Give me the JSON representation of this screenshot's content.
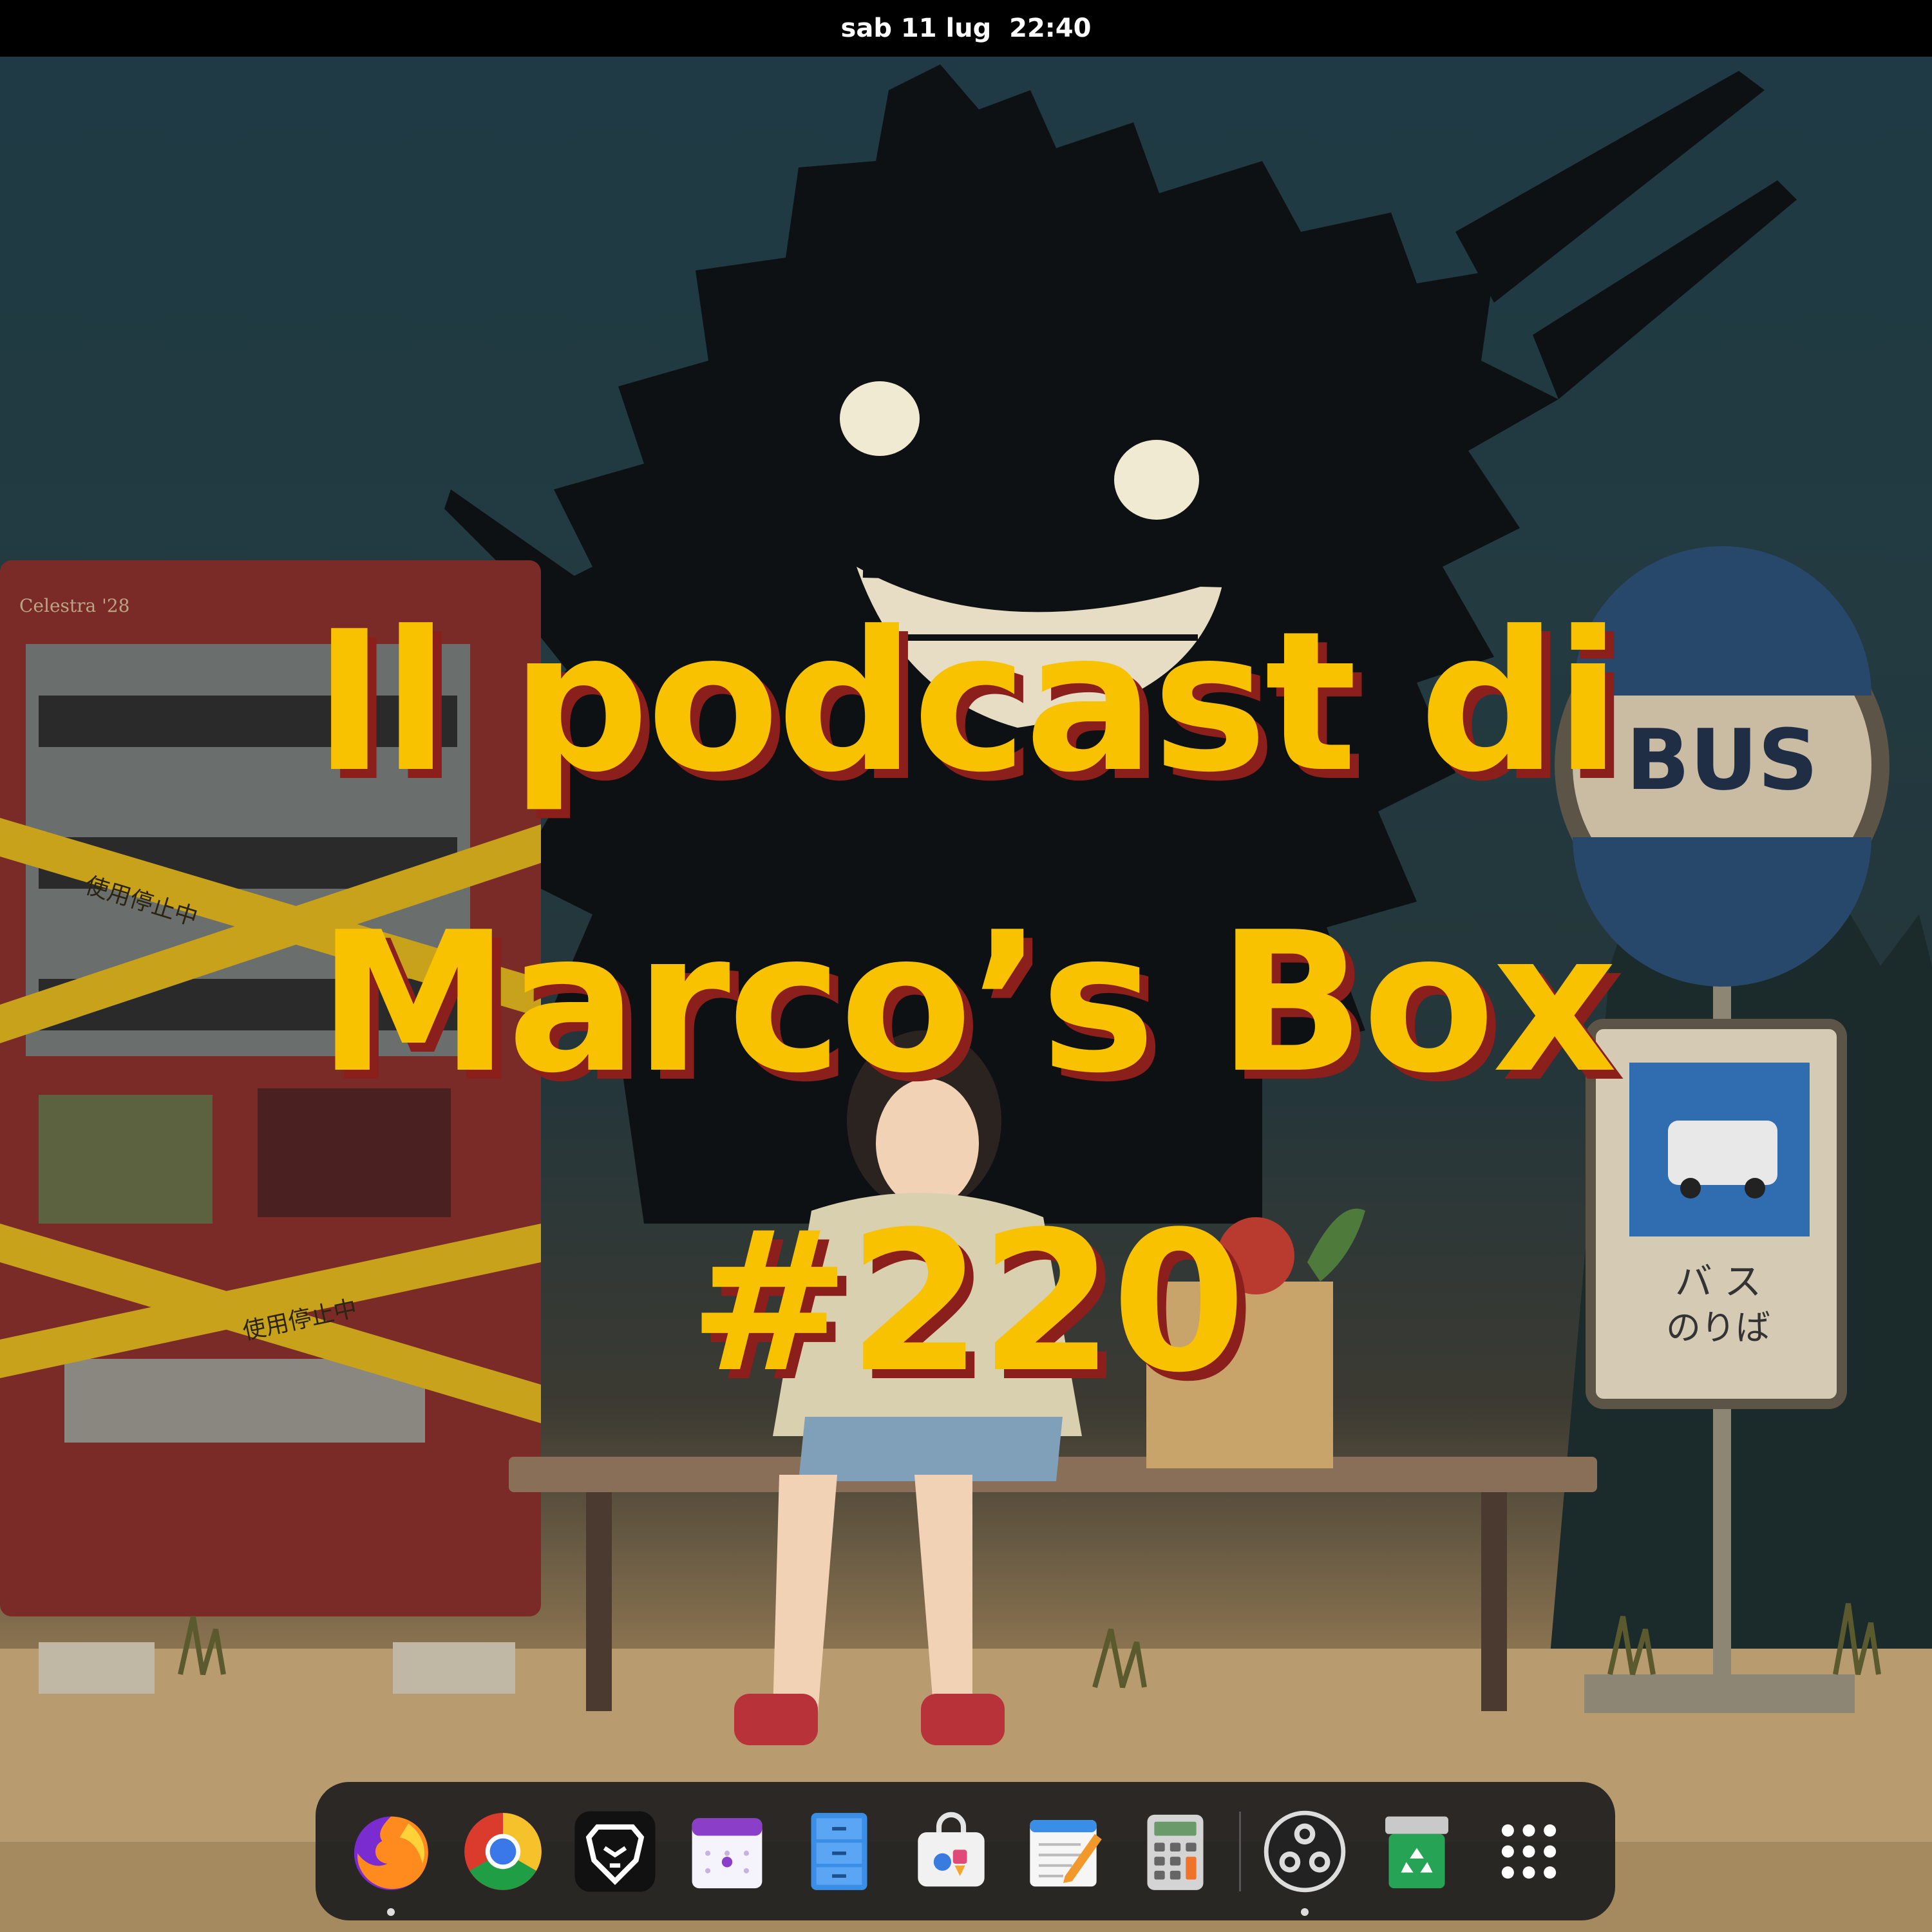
{
  "topbar": {
    "clock": "sab 11 lug  22:40"
  },
  "wallpaper": {
    "title_lines": [
      "Il podcast di",
      "Marco’s Box",
      "#220"
    ],
    "sign_top": "BUS",
    "sign_bottom_line1": "バ ス",
    "sign_bottom_line2": "のりば",
    "tape_text": "使用停止中",
    "artist_signature": "Celestra '28",
    "colors": {
      "title": "#f8c200",
      "title_shadow": "#8b1f1c"
    }
  },
  "dock": {
    "items": [
      {
        "name": "Firefox",
        "icon": "firefox-icon",
        "running": true
      },
      {
        "name": "Chrome",
        "icon": "chrome-icon",
        "running": false
      },
      {
        "name": "Brave",
        "icon": "brave-icon",
        "running": false
      },
      {
        "name": "Calendar",
        "icon": "calendar-icon",
        "running": false
      },
      {
        "name": "Files",
        "icon": "files-icon",
        "running": false
      },
      {
        "name": "Software",
        "icon": "software-store-icon",
        "running": false
      },
      {
        "name": "Text Editor",
        "icon": "text-editor-icon",
        "running": false
      },
      {
        "name": "Calculator",
        "icon": "calculator-icon",
        "running": false
      },
      {
        "name": "OBS Studio",
        "icon": "obs-icon",
        "running": true
      },
      {
        "name": "Trash",
        "icon": "trash-icon",
        "running": false
      },
      {
        "name": "Show Apps",
        "icon": "app-grid-icon",
        "running": false
      }
    ]
  }
}
